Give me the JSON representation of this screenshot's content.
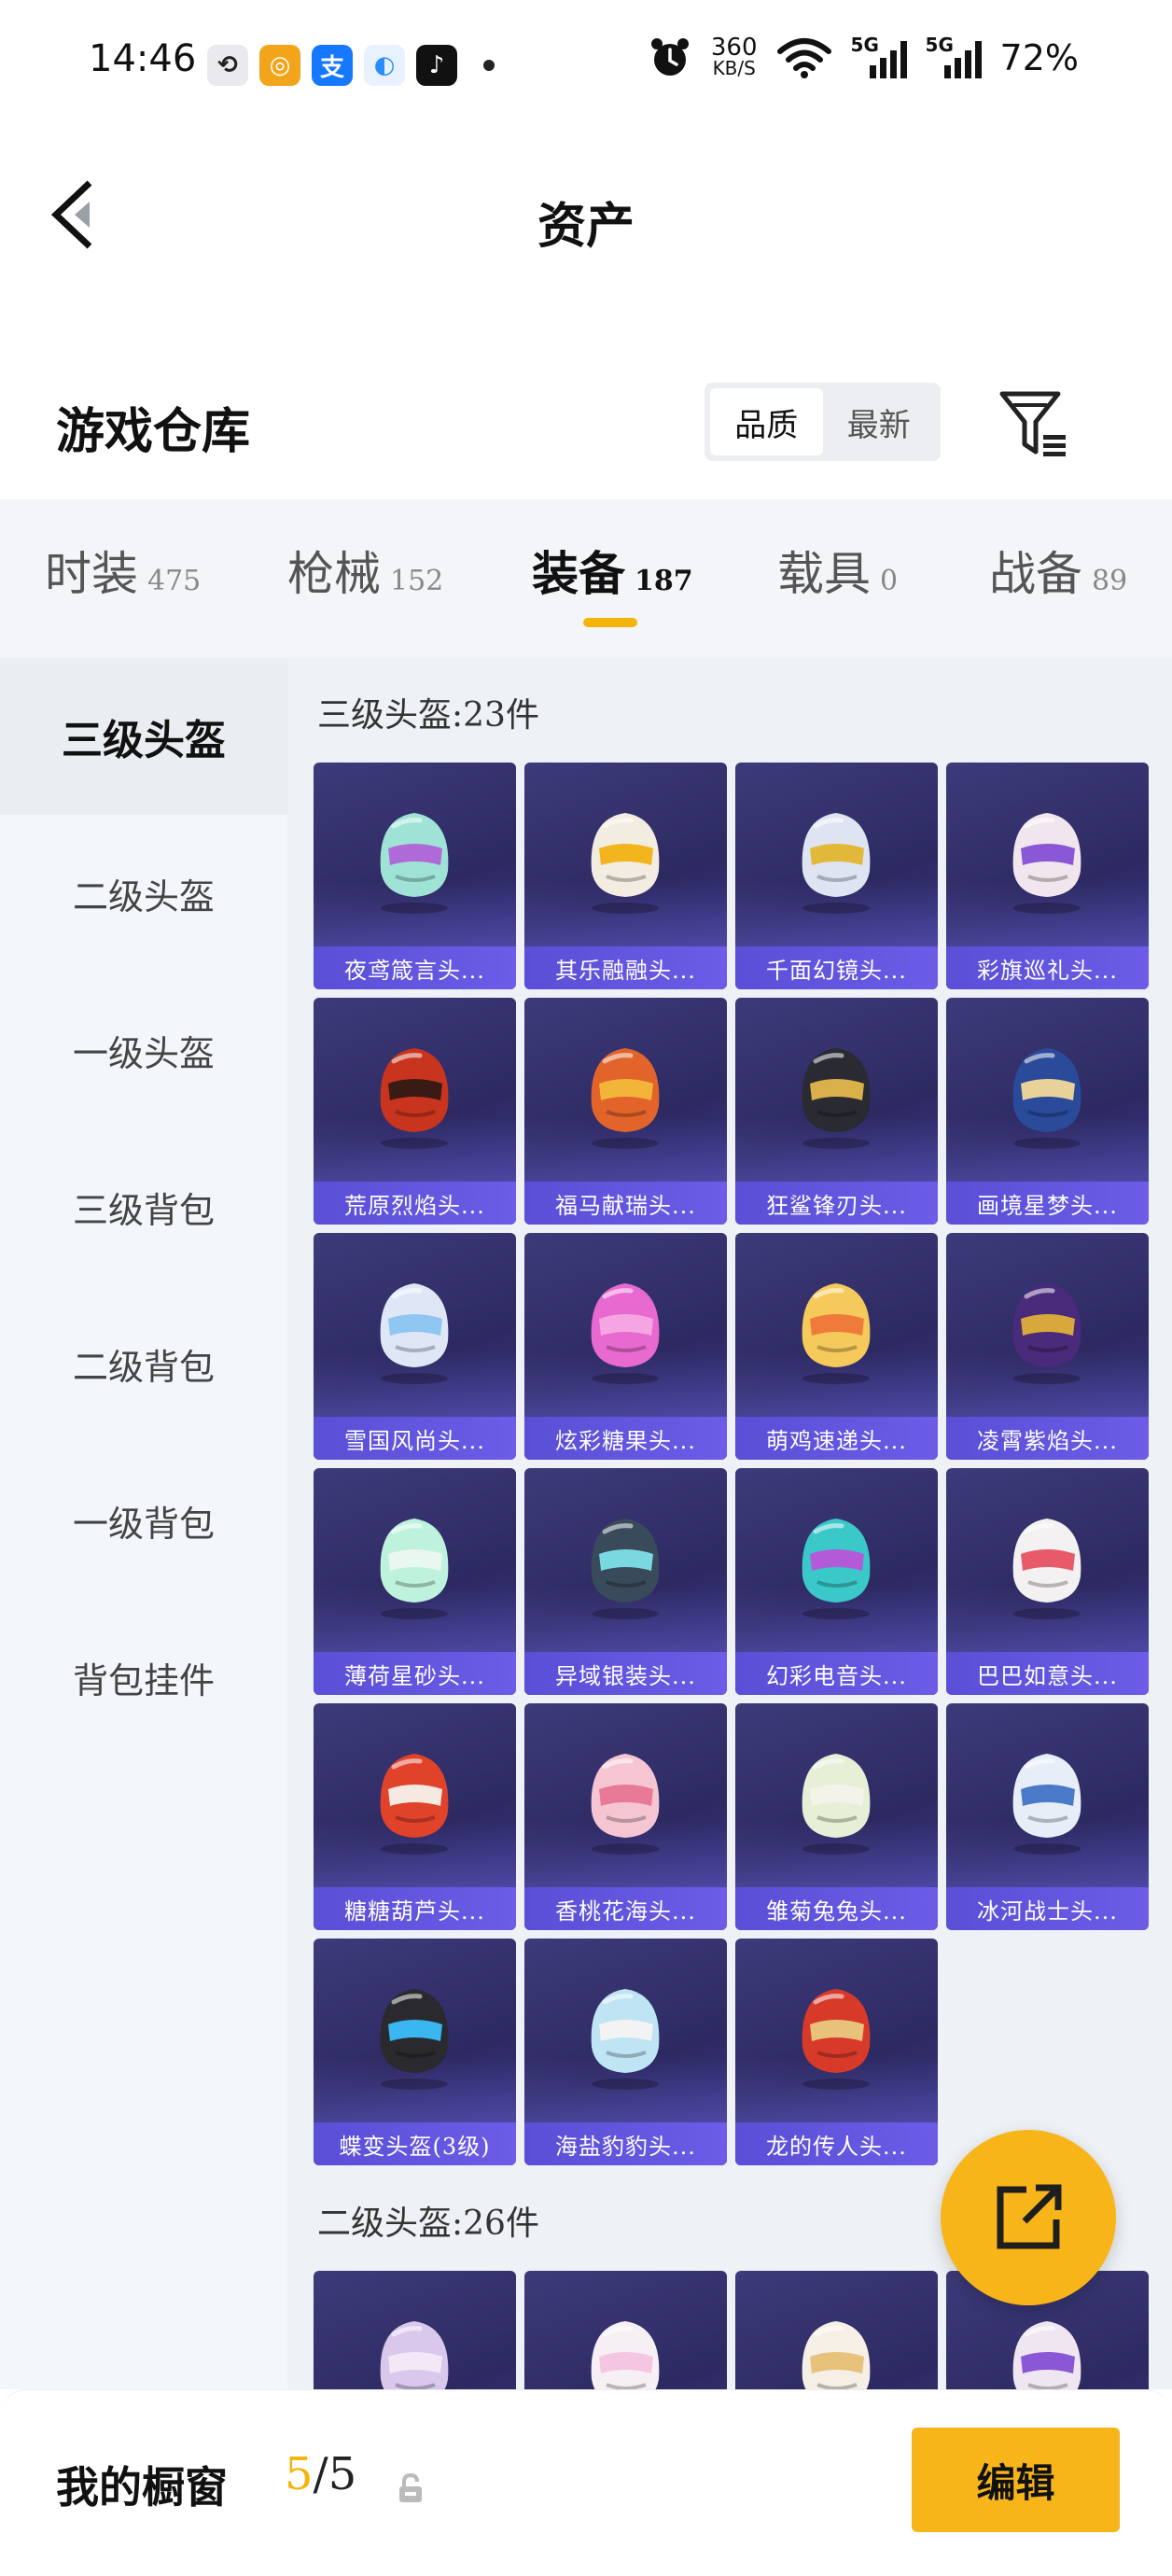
{
  "status_bar": {
    "time": "14:46",
    "apps": [
      {
        "icon": "link-app-icon",
        "glyph": "⟲",
        "color": "#e9e9ee",
        "fg": "#222"
      },
      {
        "icon": "target-app-icon",
        "glyph": "◎",
        "color": "#f2a41a",
        "fg": "#fff"
      },
      {
        "icon": "alipay-icon",
        "glyph": "支",
        "color": "#1677ff",
        "fg": "#fff"
      },
      {
        "icon": "cloud-app-icon",
        "glyph": "◐",
        "color": "#e8f1ff",
        "fg": "#2a8cff"
      },
      {
        "icon": "tiktok-icon",
        "glyph": "♪",
        "color": "#111111",
        "fg": "#fff"
      }
    ],
    "net_speed_value": "360",
    "net_speed_unit": "KB/S",
    "signal1_label": "5G",
    "signal2_label": "5G",
    "battery": "72%"
  },
  "header": {
    "title": "资产"
  },
  "warehouse": {
    "title": "游戏仓库",
    "sort_options": [
      "品质",
      "最新"
    ],
    "active_sort": "品质"
  },
  "category_tabs": [
    {
      "name": "时装",
      "count": "475"
    },
    {
      "name": "枪械",
      "count": "152"
    },
    {
      "name": "装备",
      "count": "187"
    },
    {
      "name": "载具",
      "count": "0"
    },
    {
      "name": "战备",
      "count": "89"
    }
  ],
  "active_category": "装备",
  "sidebar": {
    "items": [
      "三级头盔",
      "二级头盔",
      "一级头盔",
      "三级背包",
      "二级背包",
      "一级背包",
      "背包挂件"
    ],
    "active": "三级头盔"
  },
  "sections": [
    {
      "title": "三级头盔:23件",
      "items": [
        {
          "label": "夜鸢箴言头...",
          "c1": "#9fe3d6",
          "c2": "#b06ad8"
        },
        {
          "label": "其乐融融头...",
          "c1": "#f3ece0",
          "c2": "#f2b51e"
        },
        {
          "label": "千面幻镜头...",
          "c1": "#dfe4f2",
          "c2": "#e2b83a"
        },
        {
          "label": "彩旗巡礼头...",
          "c1": "#f2e6ee",
          "c2": "#8a58d6"
        },
        {
          "label": "荒原烈焰头...",
          "c1": "#c8341e",
          "c2": "#3a1a14"
        },
        {
          "label": "福马献瑞头...",
          "c1": "#e2642a",
          "c2": "#f3b43a"
        },
        {
          "label": "狂鲨锋刃头...",
          "c1": "#2a2a33",
          "c2": "#d9b04a"
        },
        {
          "label": "画境星梦头...",
          "c1": "#2a4a9a",
          "c2": "#e8d29a"
        },
        {
          "label": "雪国风尚头...",
          "c1": "#dfe7f7",
          "c2": "#8fc6f2"
        },
        {
          "label": "炫彩糖果头...",
          "c1": "#e86ad0",
          "c2": "#f5a6e2"
        },
        {
          "label": "萌鸡速递头...",
          "c1": "#f5c95a",
          "c2": "#f07a3a"
        },
        {
          "label": "凌霄紫焰头...",
          "c1": "#4a2a7a",
          "c2": "#d7a83a"
        },
        {
          "label": "薄荷星砂头...",
          "c1": "#bff2dc",
          "c2": "#e9f7f0"
        },
        {
          "label": "异域银装头...",
          "c1": "#394a5a",
          "c2": "#7ad8e0"
        },
        {
          "label": "幻彩电音头...",
          "c1": "#3ac8c8",
          "c2": "#b25ad8"
        },
        {
          "label": "巴巴如意头...",
          "c1": "#f3f1f1",
          "c2": "#e85a6a"
        },
        {
          "label": "糖糖葫芦头...",
          "c1": "#e0422a",
          "c2": "#f6e9e2"
        },
        {
          "label": "香桃花海头...",
          "c1": "#f5c6d2",
          "c2": "#e87a98"
        },
        {
          "label": "雏菊兔兔头...",
          "c1": "#e6f0d6",
          "c2": "#f3f3ea"
        },
        {
          "label": "冰河战士头...",
          "c1": "#e7eef7",
          "c2": "#4a7ac8"
        },
        {
          "label": "蝶变头盔(3级)",
          "c1": "#2a2a2e",
          "c2": "#3ab6f0"
        },
        {
          "label": "海盐豹豹头...",
          "c1": "#bfe4f4",
          "c2": "#f3f3f3"
        },
        {
          "label": "龙的传人头...",
          "c1": "#d83a2a",
          "c2": "#e8c27a"
        }
      ]
    },
    {
      "title": "二级头盔:26件",
      "items": [
        {
          "label": "",
          "c1": "#d9c8ec",
          "c2": "#f2e8f6"
        },
        {
          "label": "",
          "c1": "#f6f0f4",
          "c2": "#f5c6e2"
        },
        {
          "label": "",
          "c1": "#f5efe6",
          "c2": "#e8c27a"
        },
        {
          "label": "",
          "c1": "#efe6f2",
          "c2": "#8a58d6"
        }
      ]
    }
  ],
  "showcase": {
    "label": "我的橱窗",
    "current": "5",
    "total": "/5",
    "edit_label": "编辑"
  },
  "colors": {
    "accent": "#f7b51a",
    "card_label": "#6c5ce7"
  }
}
